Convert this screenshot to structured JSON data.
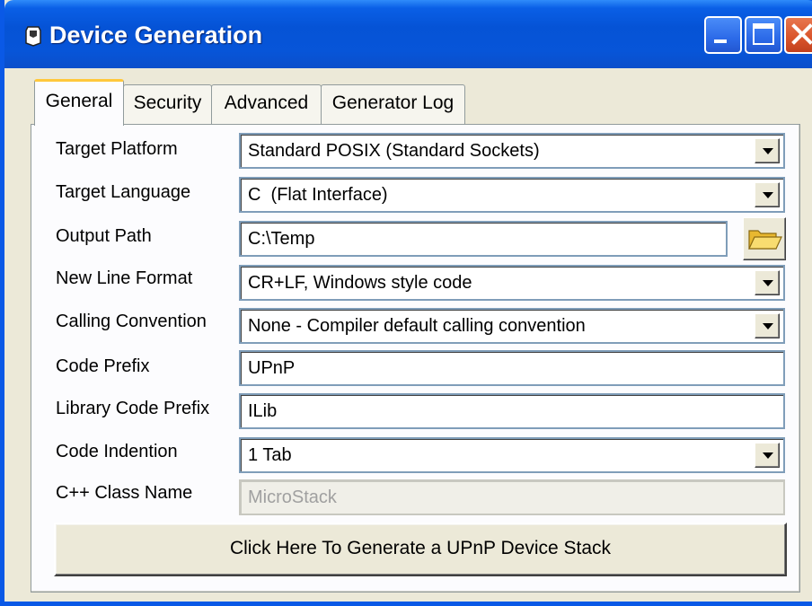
{
  "window": {
    "title": "Device Generation"
  },
  "tabs": [
    {
      "label": "General",
      "active": true
    },
    {
      "label": "Security",
      "active": false
    },
    {
      "label": "Advanced",
      "active": false
    },
    {
      "label": "Generator Log",
      "active": false
    }
  ],
  "form": {
    "target_platform": {
      "label": "Target Platform",
      "value": "Standard POSIX (Standard Sockets)"
    },
    "target_language": {
      "label": "Target Language",
      "value": "C  (Flat Interface)"
    },
    "output_path": {
      "label": "Output Path",
      "value": "C:\\Temp"
    },
    "new_line_format": {
      "label": "New Line Format",
      "value": "CR+LF, Windows style code"
    },
    "calling_convention": {
      "label": "Calling Convention",
      "value": "None - Compiler default calling convention"
    },
    "code_prefix": {
      "label": "Code Prefix",
      "value": "UPnP"
    },
    "library_code_prefix": {
      "label": "Library Code Prefix",
      "value": "ILib"
    },
    "code_indention": {
      "label": "Code Indention",
      "value": "1 Tab"
    },
    "cpp_class_name": {
      "label": "C++ Class Name",
      "value": "MicroStack"
    }
  },
  "generate_button": {
    "label": "Click Here To Generate a UPnP Device Stack"
  },
  "icons": {
    "app": "app-icon",
    "browse": "folder-icon",
    "dropdown": "chevron-down-icon",
    "minimize": "minimize-icon",
    "maximize": "maximize-icon",
    "close": "close-icon"
  },
  "colors": {
    "titlebar": "#0553d6",
    "close_button": "#d9532a",
    "face": "#ece9d8",
    "active_tab_accent": "#ffc83c"
  }
}
